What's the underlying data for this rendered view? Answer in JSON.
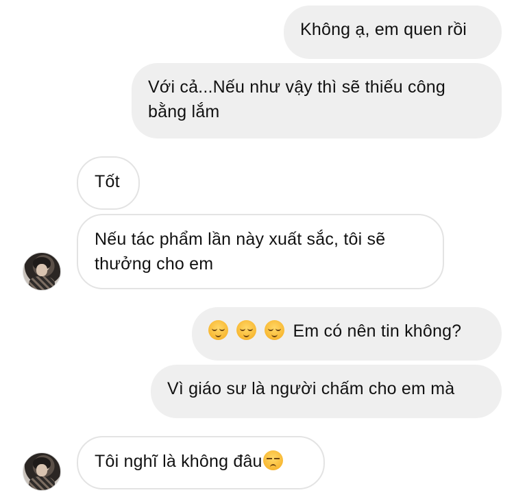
{
  "messages": [
    {
      "side": "outgoing",
      "text": "Không ạ, em quen rồi"
    },
    {
      "side": "outgoing",
      "text": "Với cả...Nếu như vậy thì sẽ thiếu công bằng lắm"
    },
    {
      "side": "incoming",
      "text": "Tốt"
    },
    {
      "side": "incoming",
      "text": "Nếu tác phẩm lần này xuất sắc, tôi sẽ thưởng cho em"
    },
    {
      "side": "outgoing",
      "emojis": [
        "relieved-face",
        "relieved-face",
        "relieved-face"
      ],
      "text": "Em có nên tin không?"
    },
    {
      "side": "outgoing",
      "text": "Vì giáo sư là người chấm cho em mà"
    },
    {
      "side": "incoming",
      "text": "Tôi nghĩ là không đâu",
      "emoji": "unamused-face"
    }
  ],
  "colors": {
    "outgoing_bubble": "#efefef",
    "incoming_bubble": "#ffffff",
    "incoming_border": "#e3e3e3",
    "text": "#111111"
  }
}
